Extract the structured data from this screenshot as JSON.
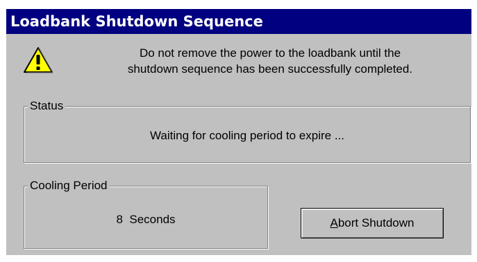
{
  "window": {
    "title": "Loadbank Shutdown Sequence"
  },
  "warning": {
    "icon": "warning-icon",
    "message_line1": "Do not remove the power to the loadbank until the",
    "message_line2": "shutdown sequence has been successfully completed."
  },
  "status": {
    "label": "Status",
    "text": "Waiting for cooling period to expire ..."
  },
  "cooling": {
    "label": "Cooling Period",
    "value": "8  Seconds"
  },
  "abort_button": {
    "mnemonic": "A",
    "label_rest": "bort Shutdown"
  },
  "colors": {
    "titlebar_bg": "#000080",
    "titlebar_text": "#ffffff",
    "dialog_bg": "#c0c0c0",
    "warning_fill": "#ffff00"
  }
}
